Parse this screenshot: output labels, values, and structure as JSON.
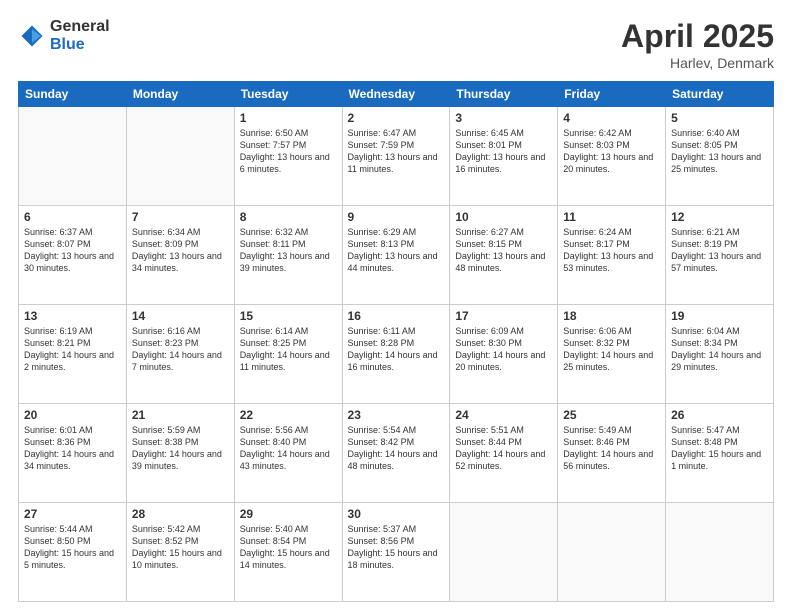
{
  "header": {
    "logo_general": "General",
    "logo_blue": "Blue",
    "title": "April 2025",
    "location": "Harlev, Denmark"
  },
  "days_of_week": [
    "Sunday",
    "Monday",
    "Tuesday",
    "Wednesday",
    "Thursday",
    "Friday",
    "Saturday"
  ],
  "weeks": [
    [
      {
        "day": "",
        "info": ""
      },
      {
        "day": "",
        "info": ""
      },
      {
        "day": "1",
        "info": "Sunrise: 6:50 AM\nSunset: 7:57 PM\nDaylight: 13 hours and 6 minutes."
      },
      {
        "day": "2",
        "info": "Sunrise: 6:47 AM\nSunset: 7:59 PM\nDaylight: 13 hours and 11 minutes."
      },
      {
        "day": "3",
        "info": "Sunrise: 6:45 AM\nSunset: 8:01 PM\nDaylight: 13 hours and 16 minutes."
      },
      {
        "day": "4",
        "info": "Sunrise: 6:42 AM\nSunset: 8:03 PM\nDaylight: 13 hours and 20 minutes."
      },
      {
        "day": "5",
        "info": "Sunrise: 6:40 AM\nSunset: 8:05 PM\nDaylight: 13 hours and 25 minutes."
      }
    ],
    [
      {
        "day": "6",
        "info": "Sunrise: 6:37 AM\nSunset: 8:07 PM\nDaylight: 13 hours and 30 minutes."
      },
      {
        "day": "7",
        "info": "Sunrise: 6:34 AM\nSunset: 8:09 PM\nDaylight: 13 hours and 34 minutes."
      },
      {
        "day": "8",
        "info": "Sunrise: 6:32 AM\nSunset: 8:11 PM\nDaylight: 13 hours and 39 minutes."
      },
      {
        "day": "9",
        "info": "Sunrise: 6:29 AM\nSunset: 8:13 PM\nDaylight: 13 hours and 44 minutes."
      },
      {
        "day": "10",
        "info": "Sunrise: 6:27 AM\nSunset: 8:15 PM\nDaylight: 13 hours and 48 minutes."
      },
      {
        "day": "11",
        "info": "Sunrise: 6:24 AM\nSunset: 8:17 PM\nDaylight: 13 hours and 53 minutes."
      },
      {
        "day": "12",
        "info": "Sunrise: 6:21 AM\nSunset: 8:19 PM\nDaylight: 13 hours and 57 minutes."
      }
    ],
    [
      {
        "day": "13",
        "info": "Sunrise: 6:19 AM\nSunset: 8:21 PM\nDaylight: 14 hours and 2 minutes."
      },
      {
        "day": "14",
        "info": "Sunrise: 6:16 AM\nSunset: 8:23 PM\nDaylight: 14 hours and 7 minutes."
      },
      {
        "day": "15",
        "info": "Sunrise: 6:14 AM\nSunset: 8:25 PM\nDaylight: 14 hours and 11 minutes."
      },
      {
        "day": "16",
        "info": "Sunrise: 6:11 AM\nSunset: 8:28 PM\nDaylight: 14 hours and 16 minutes."
      },
      {
        "day": "17",
        "info": "Sunrise: 6:09 AM\nSunset: 8:30 PM\nDaylight: 14 hours and 20 minutes."
      },
      {
        "day": "18",
        "info": "Sunrise: 6:06 AM\nSunset: 8:32 PM\nDaylight: 14 hours and 25 minutes."
      },
      {
        "day": "19",
        "info": "Sunrise: 6:04 AM\nSunset: 8:34 PM\nDaylight: 14 hours and 29 minutes."
      }
    ],
    [
      {
        "day": "20",
        "info": "Sunrise: 6:01 AM\nSunset: 8:36 PM\nDaylight: 14 hours and 34 minutes."
      },
      {
        "day": "21",
        "info": "Sunrise: 5:59 AM\nSunset: 8:38 PM\nDaylight: 14 hours and 39 minutes."
      },
      {
        "day": "22",
        "info": "Sunrise: 5:56 AM\nSunset: 8:40 PM\nDaylight: 14 hours and 43 minutes."
      },
      {
        "day": "23",
        "info": "Sunrise: 5:54 AM\nSunset: 8:42 PM\nDaylight: 14 hours and 48 minutes."
      },
      {
        "day": "24",
        "info": "Sunrise: 5:51 AM\nSunset: 8:44 PM\nDaylight: 14 hours and 52 minutes."
      },
      {
        "day": "25",
        "info": "Sunrise: 5:49 AM\nSunset: 8:46 PM\nDaylight: 14 hours and 56 minutes."
      },
      {
        "day": "26",
        "info": "Sunrise: 5:47 AM\nSunset: 8:48 PM\nDaylight: 15 hours and 1 minute."
      }
    ],
    [
      {
        "day": "27",
        "info": "Sunrise: 5:44 AM\nSunset: 8:50 PM\nDaylight: 15 hours and 5 minutes."
      },
      {
        "day": "28",
        "info": "Sunrise: 5:42 AM\nSunset: 8:52 PM\nDaylight: 15 hours and 10 minutes."
      },
      {
        "day": "29",
        "info": "Sunrise: 5:40 AM\nSunset: 8:54 PM\nDaylight: 15 hours and 14 minutes."
      },
      {
        "day": "30",
        "info": "Sunrise: 5:37 AM\nSunset: 8:56 PM\nDaylight: 15 hours and 18 minutes."
      },
      {
        "day": "",
        "info": ""
      },
      {
        "day": "",
        "info": ""
      },
      {
        "day": "",
        "info": ""
      }
    ]
  ]
}
